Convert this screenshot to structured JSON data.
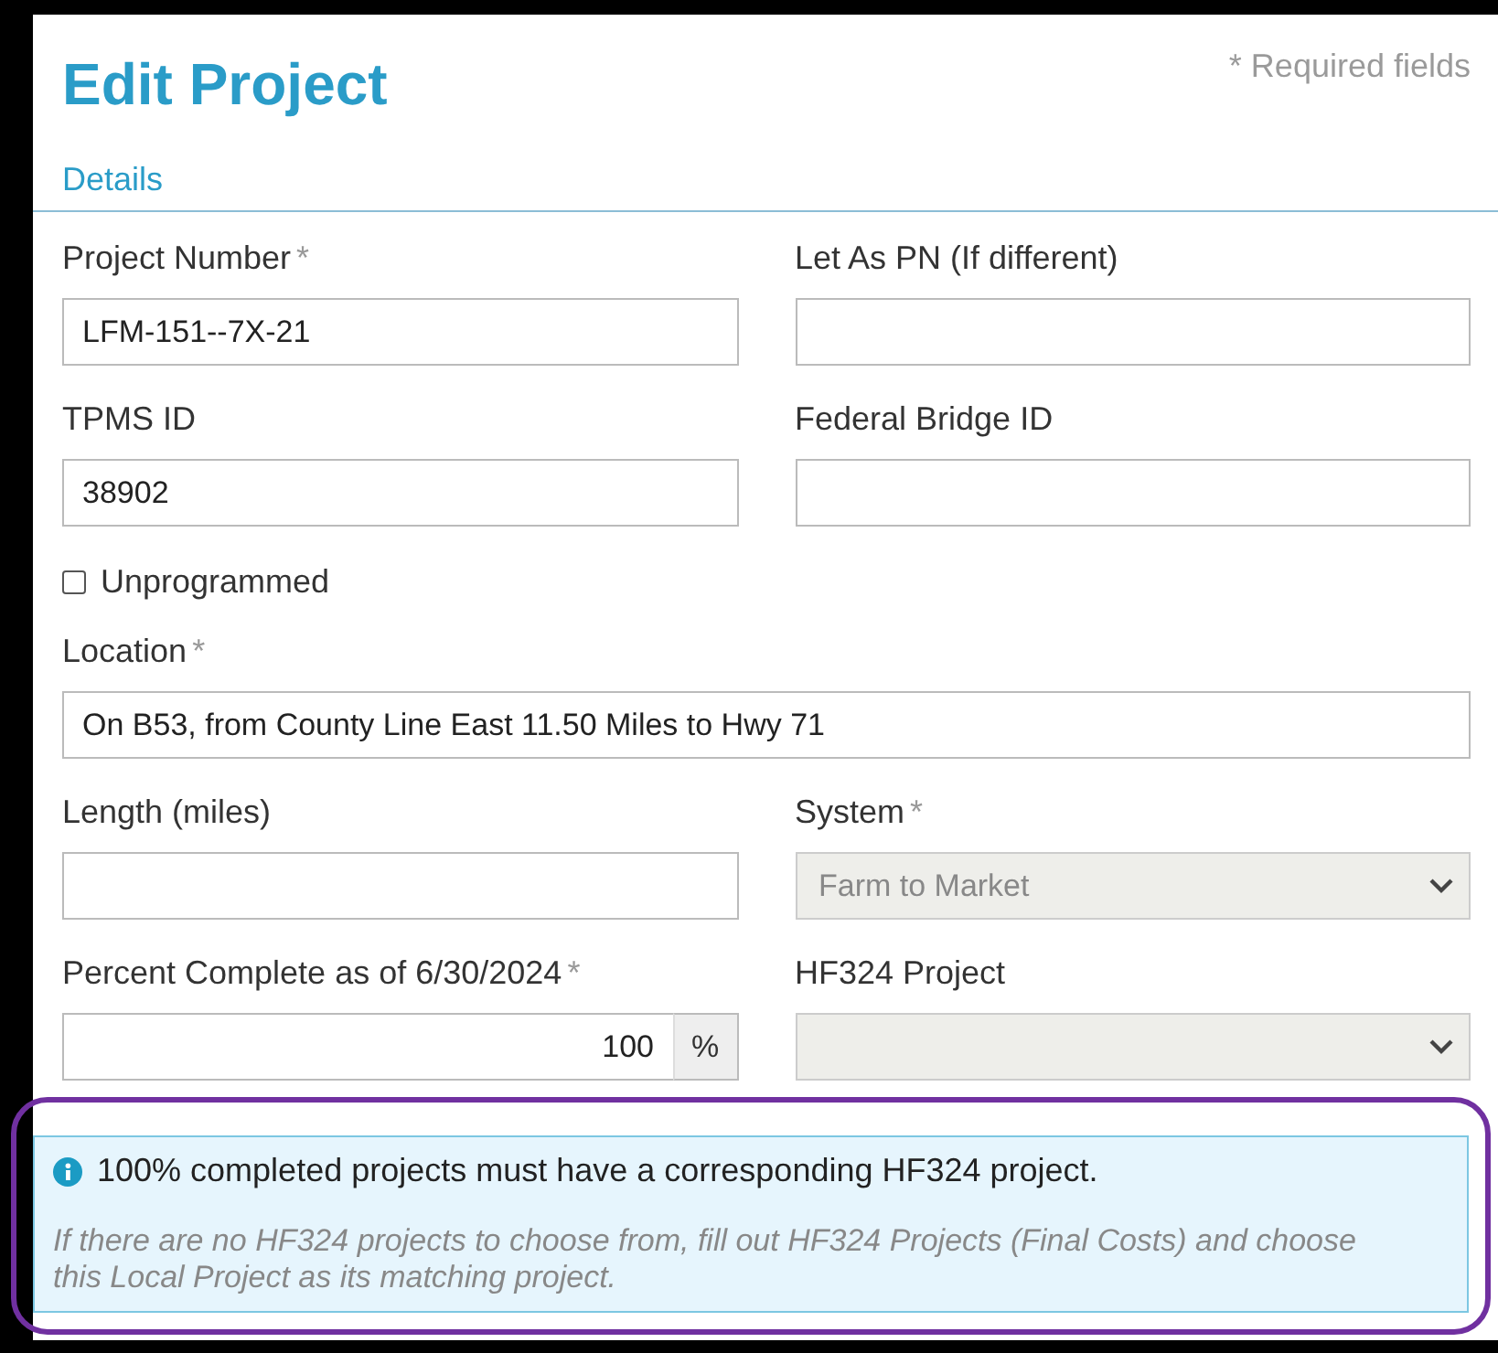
{
  "title": "Edit Project",
  "required_note": "* Required fields",
  "section": "Details",
  "rows": [
    [
      {
        "kind": "text",
        "label": "Project Number",
        "required_mark": "*",
        "value": "LFM-151--7X-21"
      },
      {
        "kind": "text",
        "label": "Let As PN (If different)"
      }
    ],
    [
      {
        "kind": "text",
        "label": "TPMS ID",
        "value": "38902"
      },
      {
        "kind": "text",
        "label": "Federal Bridge ID"
      }
    ],
    [
      {
        "kind": "checkbox",
        "label": "Unprogrammed",
        "checked": false
      }
    ],
    [
      {
        "kind": "text",
        "label": "Location",
        "required_mark": "*",
        "value": "On B53, from County Line East 11.50 Miles to Hwy 71"
      }
    ],
    [
      {
        "kind": "text",
        "label": "Length (miles)"
      },
      {
        "kind": "select",
        "label": "System",
        "required_mark": "*",
        "value": "Farm to Market",
        "disabled": true
      }
    ],
    [
      {
        "kind": "percent",
        "label": "Percent Complete as of 6/30/2024",
        "required_mark": "*",
        "value": "100",
        "unit": "%"
      },
      {
        "kind": "select",
        "label": "HF324 Project",
        "disabled": true
      }
    ]
  ],
  "alert": {
    "message": "100% completed projects must have a corresponding HF324 project.",
    "note": "If there are no HF324 projects to choose from, fill out HF324 Projects (Final Costs) and choose this Local Project as its matching project.",
    "highlighted": true
  }
}
